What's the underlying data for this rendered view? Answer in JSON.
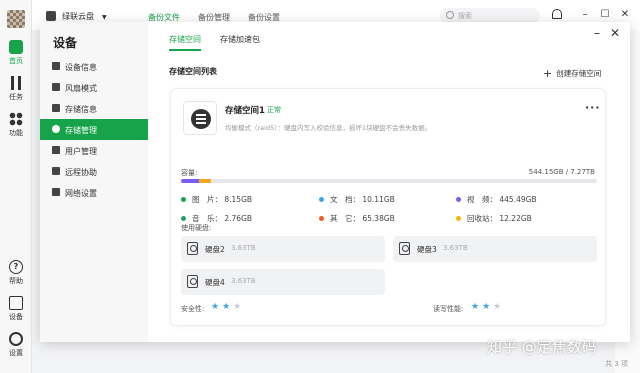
{
  "rail": {
    "home_label": "首页",
    "tasks_label": "任务",
    "features_label": "功能",
    "help_label": "帮助",
    "device_label": "设备",
    "settings_label": "设置"
  },
  "background": {
    "account_name": "绿联云盘",
    "tabs": [
      "备份文件",
      "备份管理",
      "备份设置"
    ],
    "search_placeholder": "搜索",
    "footer_count": "共 3 项"
  },
  "modal": {
    "nav_title": "设备",
    "nav_items": [
      "设备信息",
      "风扇模式",
      "存储信息",
      "存储管理",
      "用户管理",
      "远程协助",
      "网络设置"
    ],
    "active_nav_index": 3,
    "tabs": [
      "存储空间",
      "存储加速包"
    ],
    "section_title": "存储空间列表",
    "create_button": "创建存储空间",
    "card": {
      "name": "存储空间1",
      "status": "正常",
      "description": "均衡模式（raid5）：硬盘内写入校验信息，损坏1块硬盘不会丢失数据。",
      "capacity_label": "容量:",
      "capacity_value": "544.15GB / 7.27TB",
      "usage_fraction": 0.0731,
      "segments": [
        {
          "color": "#7c5cf5",
          "fraction": 0.6
        },
        {
          "color": "#f5a623",
          "fraction": 0.4
        }
      ],
      "legend": [
        {
          "label": "图　片：",
          "value": "8.15GB",
          "color": "#16a34a"
        },
        {
          "label": "文　档：",
          "value": "10.11GB",
          "color": "#3ba6e8"
        },
        {
          "label": "视　频：",
          "value": "445.49GB",
          "color": "#7c5cf5"
        },
        {
          "label": "音　乐：",
          "value": "2.76GB",
          "color": "#22a06b"
        },
        {
          "label": "其　它：",
          "value": "65.38GB",
          "color": "#f05a28"
        },
        {
          "label": "回收站：",
          "value": "12.22GB",
          "color": "#f5b700"
        }
      ],
      "disks_label": "使用硬盘:",
      "disks": [
        {
          "name": "硬盘2",
          "size": "3.63TB"
        },
        {
          "name": "硬盘3",
          "size": "3.63TB"
        },
        {
          "name": "硬盘4",
          "size": "3.63TB"
        }
      ],
      "safety_label": "安全性:",
      "safety_stars": 2,
      "speed_label": "读写性能:",
      "speed_stars": 2,
      "max_stars": 3
    }
  },
  "watermark": "知乎 @定焦数码",
  "colors": {
    "accent": "#16a34a",
    "star": "#3ba6e8"
  }
}
